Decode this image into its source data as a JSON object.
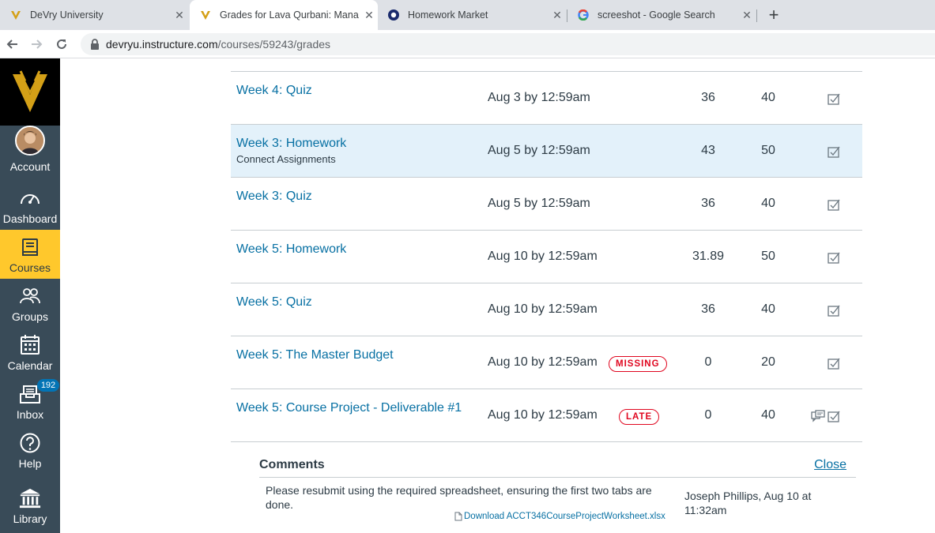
{
  "browser": {
    "tabs": [
      {
        "title": "DeVry University",
        "close": "✕"
      },
      {
        "title": "Grades for Lava Qurbani: Mana",
        "close": "✕"
      },
      {
        "title": "Homework Market",
        "close": "✕"
      },
      {
        "title": "screeshot - Google Search",
        "close": "✕"
      }
    ],
    "new_tab": "+",
    "url_host": "devryu.instructure.com",
    "url_path": "/courses/59243/grades"
  },
  "sidebar": {
    "account": "Account",
    "dashboard": "Dashboard",
    "courses": "Courses",
    "groups": "Groups",
    "calendar": "Calendar",
    "inbox": "Inbox",
    "inbox_badge": "192",
    "help": "Help",
    "library": "Library",
    "colors": {
      "bg": "#394b58",
      "active": "#ffc82c",
      "badge": "#0374b5"
    }
  },
  "assignments": [
    {
      "title": "Week 4: Quiz",
      "subtitle": "",
      "due": "Aug 3 by 12:59am",
      "status": "",
      "score": "36",
      "possible": "40"
    },
    {
      "title": "Week 3: Homework",
      "subtitle": "Connect Assignments",
      "due": "Aug 5 by 12:59am",
      "status": "",
      "score": "43",
      "possible": "50"
    },
    {
      "title": "Week 3: Quiz",
      "subtitle": "",
      "due": "Aug 5 by 12:59am",
      "status": "",
      "score": "36",
      "possible": "40"
    },
    {
      "title": "Week 5: Homework",
      "subtitle": "",
      "due": "Aug 10 by 12:59am",
      "status": "",
      "score": "31.89",
      "possible": "50"
    },
    {
      "title": "Week 5: Quiz",
      "subtitle": "",
      "due": "Aug 10 by 12:59am",
      "status": "",
      "score": "36",
      "possible": "40"
    },
    {
      "title": "Week 5: The Master Budget",
      "subtitle": "",
      "due": "Aug 10 by 12:59am",
      "status": "MISSING",
      "score": "0",
      "possible": "20"
    },
    {
      "title": "Week 5: Course Project - Deliverable #1",
      "subtitle": "",
      "due": "Aug 10 by 12:59am",
      "status": "LATE",
      "score": "0",
      "possible": "40"
    }
  ],
  "comments": {
    "heading": "Comments",
    "close": "Close",
    "text": "Please resubmit using the required spreadsheet, ensuring the first two tabs are done.",
    "author": "Joseph Phillips, Aug 10 at 11:32am",
    "attachment": "Download ACCT346CourseProjectWorksheet.xlsx"
  },
  "icons": [
    "devry-logo",
    "canvas-favicon",
    "homework-market-favicon",
    "google-favicon",
    "back-icon",
    "forward-icon",
    "reload-icon",
    "lock-icon",
    "dashboard-icon",
    "courses-icon",
    "groups-icon",
    "calendar-icon",
    "inbox-icon",
    "help-icon",
    "library-icon",
    "muted-toggle-icon",
    "comment-icon",
    "file-icon"
  ],
  "accent_colors": {
    "link": "#0770a3",
    "missing": "#e0061f",
    "highlight_row": "#e3f1fa"
  }
}
